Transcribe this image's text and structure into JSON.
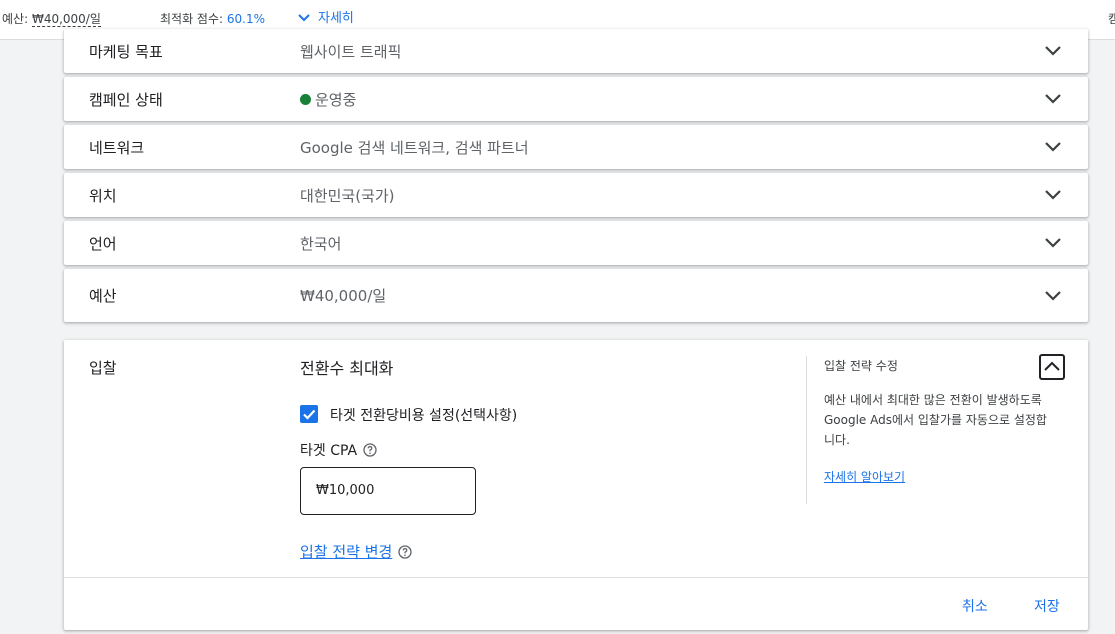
{
  "topbar": {
    "budget_label": "예산: ",
    "budget_value": "₩40,000/일",
    "optimization_label": "최적화 점수: ",
    "optimization_value": "60.1%",
    "details_label": "자세히",
    "edge_text": "캠"
  },
  "settings": [
    {
      "label": "마케팅 목표",
      "value": "웹사이트 트래픽"
    },
    {
      "label": "캠페인 상태",
      "value": "운영중",
      "status_color": "#188038"
    },
    {
      "label": "네트워크",
      "value": "Google 검색 네트워크, 검색 파트너"
    },
    {
      "label": "위치",
      "value": "대한민국(국가)"
    },
    {
      "label": "언어",
      "value": "한국어"
    },
    {
      "label": "예산",
      "value": "₩40,000/일"
    }
  ],
  "bidding": {
    "label": "입찰",
    "strategy": "전환수 최대화",
    "target_cpa_checkbox_label": "타겟 전환당비용 설정(선택사항)",
    "target_cpa_checked": true,
    "target_cpa_label": "타겟 CPA",
    "target_cpa_value": "₩10,000",
    "change_strategy_link": "입찰 전략 변경",
    "side_title": "입찰 전략 수정",
    "side_description": "예산 내에서 최대한 많은 전환이 발생하도록 Google Ads에서 입찰가를 자동으로 설정합니다.",
    "side_link": "자세히 알아보기",
    "cancel_label": "취소",
    "save_label": "저장"
  },
  "colors": {
    "accent": "#1a73e8",
    "status_active": "#188038"
  }
}
